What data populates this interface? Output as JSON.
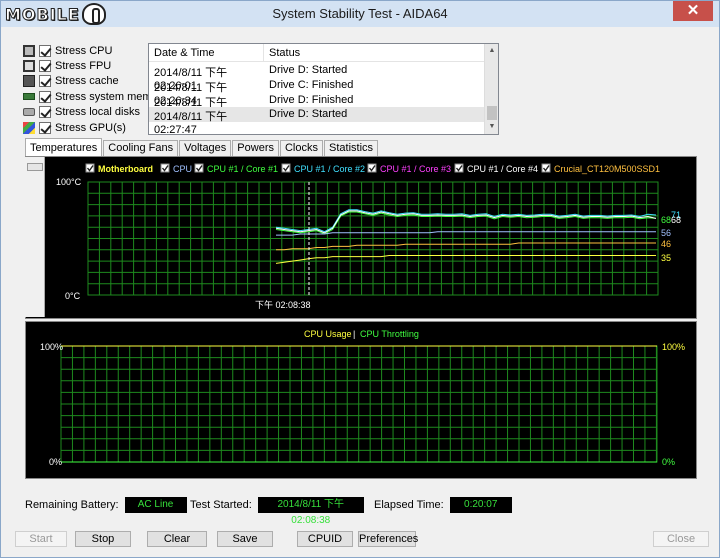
{
  "window": {
    "logo_text": "MOBILE",
    "title": "System Stability Test - AIDA64",
    "close_glyph": "✕"
  },
  "stress_options": [
    {
      "label": "Stress CPU",
      "icon": "cpu-icon",
      "checked": true
    },
    {
      "label": "Stress FPU",
      "icon": "fpu-icon",
      "checked": true
    },
    {
      "label": "Stress cache",
      "icon": "cache-icon",
      "checked": true
    },
    {
      "label": "Stress system memory",
      "icon": "memory-icon",
      "checked": true
    },
    {
      "label": "Stress local disks",
      "icon": "disk-icon",
      "checked": true
    },
    {
      "label": "Stress GPU(s)",
      "icon": "gpu-icon",
      "checked": true
    }
  ],
  "log": {
    "headers": [
      "Date & Time",
      "Status"
    ],
    "rows": [
      {
        "time": "2014/8/11 下午 02:26:01",
        "status": "Drive D: Started"
      },
      {
        "time": "2014/8/11 下午 02:26:34",
        "status": "Drive C: Finished"
      },
      {
        "time": "2014/8/11 下午 02:27:47",
        "status": "Drive D: Finished"
      },
      {
        "time": "2014/8/11 下午 02:27:47",
        "status": "Drive D: Started"
      }
    ]
  },
  "tabs": [
    "Temperatures",
    "Cooling Fans",
    "Voltages",
    "Powers",
    "Clocks",
    "Statistics"
  ],
  "active_tab": "Temperatures",
  "temperature_chart": {
    "legend": [
      {
        "label": "Motherboard",
        "color": "#ffff40"
      },
      {
        "label": "CPU",
        "color": "#a0c0ff"
      },
      {
        "label": "CPU #1 / Core #1",
        "color": "#40ff40"
      },
      {
        "label": "CPU #1 / Core #2",
        "color": "#40e0ff"
      },
      {
        "label": "CPU #1 / Core #3",
        "color": "#ff40ff"
      },
      {
        "label": "CPU #1 / Core #4",
        "color": "#ffffff"
      },
      {
        "label": "Crucial_CT120M500SSD1",
        "color": "#ffc040"
      }
    ],
    "y_top_label": "100°C",
    "y_bottom_label": "0°C",
    "marker_label": "下午 02:08:38",
    "end_labels": [
      {
        "text": "71",
        "color": "#40e0ff"
      },
      {
        "text": "68",
        "color": "#40ff40"
      },
      {
        "text": "68",
        "color": "#ffffff"
      },
      {
        "text": "56",
        "color": "#a0c0ff"
      },
      {
        "text": "46",
        "color": "#ffc040"
      },
      {
        "text": "35",
        "color": "#ffff40"
      }
    ]
  },
  "chart_data": [
    {
      "type": "line",
      "ylim": [
        0,
        100
      ],
      "grid": true,
      "series": [
        {
          "name": "CPU #1 / Core #1",
          "color": "#40ff40",
          "values": [
            58,
            57,
            56,
            55,
            56,
            57,
            54,
            58,
            70,
            74,
            73,
            72,
            71,
            72,
            71,
            70,
            70,
            71,
            70,
            69,
            70,
            70,
            69,
            70,
            69,
            69,
            70,
            68,
            69,
            69,
            70,
            68,
            69,
            70,
            69,
            68,
            69,
            69,
            68,
            69,
            68,
            68,
            69,
            68,
            69,
            68,
            68,
            68
          ]
        },
        {
          "name": "CPU #1 / Core #2",
          "color": "#40e0ff",
          "values": [
            60,
            59,
            58,
            57,
            58,
            59,
            56,
            60,
            72,
            76,
            75,
            74,
            73,
            74,
            73,
            72,
            72,
            73,
            72,
            71,
            72,
            72,
            71,
            72,
            71,
            71,
            72,
            70,
            71,
            71,
            72,
            70,
            71,
            72,
            71,
            70,
            71,
            71,
            70,
            71,
            70,
            70,
            71,
            70,
            71,
            70,
            71,
            71
          ]
        },
        {
          "name": "CPU #1 / Core #4",
          "color": "#ffffff",
          "values": [
            59,
            58,
            57,
            56,
            57,
            58,
            55,
            59,
            71,
            75,
            74,
            73,
            72,
            73,
            72,
            71,
            71,
            72,
            71,
            70,
            71,
            71,
            70,
            71,
            70,
            70,
            71,
            69,
            70,
            70,
            71,
            69,
            70,
            71,
            70,
            69,
            70,
            70,
            69,
            70,
            69,
            69,
            70,
            69,
            70,
            69,
            69,
            68
          ]
        },
        {
          "name": "CPU",
          "color": "#a0c0ff",
          "values": [
            53,
            53,
            53,
            54,
            54,
            54,
            54,
            55,
            55,
            55,
            55,
            55,
            55,
            55,
            55,
            55,
            55,
            55,
            55,
            55,
            56,
            56,
            56,
            56,
            56,
            56,
            56,
            56,
            56,
            56,
            56,
            56,
            56,
            56,
            56,
            56,
            56,
            56,
            56,
            56,
            56,
            56,
            56,
            56,
            56,
            56,
            56,
            56
          ]
        },
        {
          "name": "Crucial_CT120M500SSD1",
          "color": "#ffc040",
          "values": [
            40,
            40,
            41,
            41,
            41,
            42,
            42,
            43,
            43,
            43,
            44,
            44,
            44,
            44,
            44,
            44,
            45,
            45,
            45,
            45,
            45,
            45,
            45,
            45,
            45,
            45,
            45,
            45,
            45,
            45,
            46,
            46,
            46,
            46,
            46,
            46,
            46,
            46,
            46,
            46,
            46,
            46,
            46,
            46,
            46,
            46,
            46,
            46
          ]
        },
        {
          "name": "Motherboard",
          "color": "#ffff40",
          "values": [
            28,
            29,
            30,
            31,
            32,
            33,
            33,
            34,
            34,
            34,
            34,
            34,
            34,
            34,
            35,
            35,
            35,
            35,
            35,
            35,
            35,
            35,
            35,
            35,
            35,
            35,
            35,
            35,
            35,
            35,
            35,
            35,
            35,
            35,
            35,
            35,
            35,
            35,
            35,
            35,
            35,
            35,
            35,
            35,
            35,
            35,
            35,
            35
          ]
        }
      ]
    },
    {
      "type": "line",
      "ylim": [
        0,
        100
      ],
      "grid": true,
      "title_parts": [
        {
          "label": "CPU Usage",
          "color": "#ffff40"
        },
        {
          "label": "CPU Throttling",
          "color": "#40ff40"
        }
      ],
      "y_left_top": "100%",
      "y_left_bottom": "0%",
      "y_right_top": "100%",
      "y_right_bottom": "0%",
      "series": [
        {
          "name": "CPU Usage",
          "color": "#ffff40",
          "values": [
            100,
            100
          ]
        },
        {
          "name": "CPU Throttling",
          "color": "#40ff40",
          "values": [
            0,
            0
          ]
        }
      ]
    }
  ],
  "status": {
    "battery_label": "Remaining Battery:",
    "battery_value": "AC Line",
    "started_label": "Test Started:",
    "started_value": "2014/8/11 下午 02:08:38",
    "elapsed_label": "Elapsed Time:",
    "elapsed_value": "0:20:07"
  },
  "buttons": {
    "start": "Start",
    "stop": "Stop",
    "clear": "Clear",
    "save": "Save",
    "cpuid": "CPUID",
    "preferences": "Preferences",
    "close": "Close"
  }
}
